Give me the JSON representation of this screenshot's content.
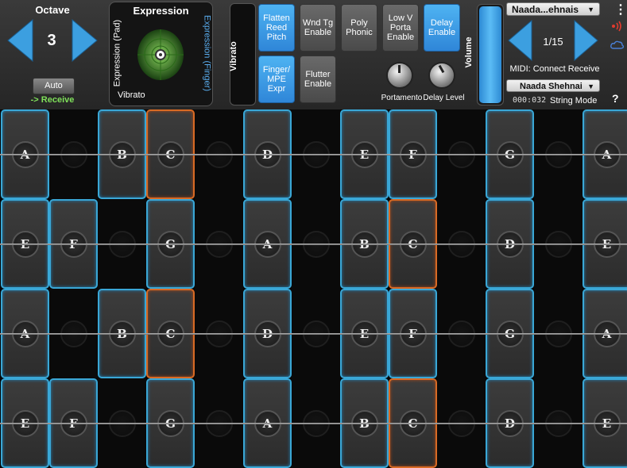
{
  "octave": {
    "title": "Octave",
    "value": "3",
    "auto_label": "Auto",
    "receive_label": "-> Receive"
  },
  "expression": {
    "title": "Expression",
    "pad_label": "Expression (Pad)",
    "finger_label": "Expression (Finger)",
    "vibrato_label": "Vibrato"
  },
  "vibrato_slot_label": "Vibrato",
  "toggles": [
    {
      "label": "Flatten\nReed\nPitch",
      "state": "on"
    },
    {
      "label": "Wnd Tg\nEnable",
      "state": "off"
    },
    {
      "label": "Poly\nPhonic",
      "state": "off"
    },
    {
      "label": "Low V\nPorta\nEnable",
      "state": "off"
    },
    {
      "label": "Delay\nEnable",
      "state": "on"
    },
    {
      "label": "Finger/\nMPE\nExpr",
      "state": "on"
    },
    {
      "label": "Flutter\nEnable",
      "state": "off"
    }
  ],
  "knobs": {
    "portamento_label": "Portamento",
    "delay_label": "Delay Level"
  },
  "volume_label": "Volume",
  "preset": {
    "name": "Naada...ehnais",
    "counter": "1/15",
    "midi_status": "MIDI: Connect Receive",
    "instrument": "Naada Shehnai",
    "code": "000:032",
    "mode": "String Mode"
  },
  "side_icons": {
    "menu": "kebab-menu-icon",
    "signal": "wifi-signal-icon",
    "cloud": "cloud-icon",
    "help": "?"
  },
  "colors": {
    "accent_blue": "#3aa7d6",
    "accent_orange": "#d86a24",
    "toggle_on": "#4eb3f2",
    "receive_green": "#7fe05a"
  },
  "grid": {
    "rows": [
      [
        "A",
        "",
        "B",
        "C",
        "",
        "D",
        "",
        "E",
        "F",
        "",
        "G",
        "",
        "A"
      ],
      [
        "E",
        "F",
        "",
        "G",
        "",
        "A",
        "",
        "B",
        "C",
        "",
        "D",
        "",
        "E"
      ],
      [
        "A",
        "",
        "B",
        "C",
        "",
        "D",
        "",
        "E",
        "F",
        "",
        "G",
        "",
        "A"
      ],
      [
        "E",
        "F",
        "",
        "G",
        "",
        "A",
        "",
        "B",
        "C",
        "",
        "D",
        "",
        "E"
      ]
    ],
    "orange": [
      [
        0,
        3
      ],
      [
        1,
        8
      ],
      [
        2,
        3
      ],
      [
        3,
        8
      ]
    ]
  }
}
